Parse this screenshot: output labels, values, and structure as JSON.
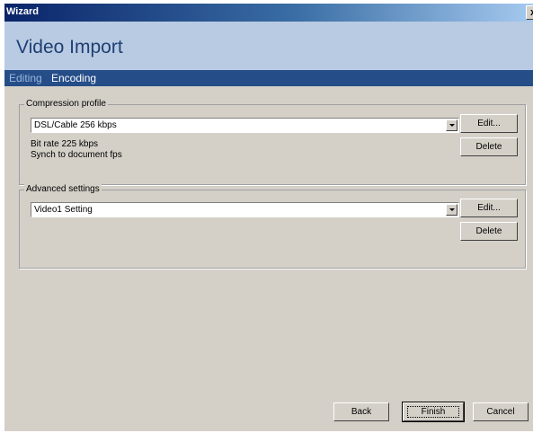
{
  "window": {
    "title": "Wizard",
    "close_label": "x"
  },
  "header": {
    "title": "Video Import"
  },
  "tabs": [
    {
      "label": "Editing"
    },
    {
      "label": "Encoding"
    }
  ],
  "compression": {
    "legend": "Compression profile",
    "selected": "DSL/Cable 256 kbps",
    "info": [
      "Bit rate 225 kbps",
      "Synch to document fps"
    ],
    "edit_label": "Edit...",
    "delete_label": "Delete"
  },
  "advanced": {
    "legend": "Advanced settings",
    "selected": "Video1 Setting",
    "edit_label": "Edit...",
    "delete_label": "Delete"
  },
  "footer": {
    "back_label": "Back",
    "finish_label": "Finish",
    "cancel_label": "Cancel"
  }
}
